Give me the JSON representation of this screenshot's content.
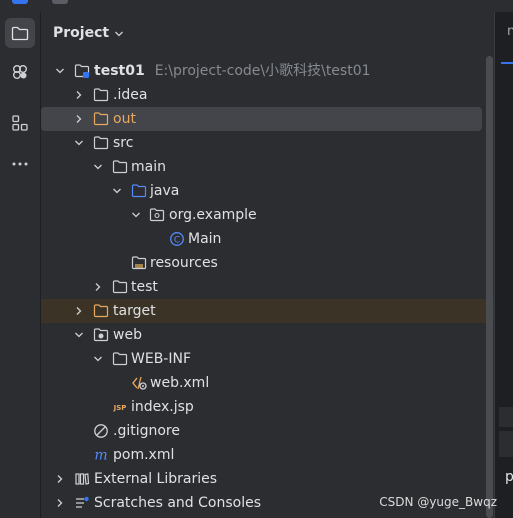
{
  "panel": {
    "title": "Project"
  },
  "tree": {
    "root": {
      "name": "test01",
      "path": "E:\\project-code\\小歌科技\\test01"
    },
    "idea": ".idea",
    "out": "out",
    "src": "src",
    "main": "main",
    "java": "java",
    "package": "org.example",
    "main_class": "Main",
    "resources": "resources",
    "test": "test",
    "target": "target",
    "web": "web",
    "web_inf": "WEB-INF",
    "web_xml": "web.xml",
    "index_jsp": "index.jsp",
    "gitignore": ".gitignore",
    "pom": "pom.xml",
    "external_libraries": "External Libraries",
    "scratches": "Scratches and Consoles"
  },
  "editor": {
    "tab_fragment": "n",
    "bottom_fragment": "p"
  },
  "watermark": "CSDN @yuge_Bwqz",
  "colors": {
    "background": "#2b2d30",
    "selection": "#43454a",
    "excluded_highlight": "#3b3426",
    "excluded_text": "#e8a85f",
    "accent_blue": "#3574f0",
    "folder_grey": "#ced0d6",
    "source_blue": "#548af7"
  },
  "icons": {
    "activity": [
      "project-folder-icon",
      "plugins-icon",
      "structure-icon",
      "more-icon"
    ]
  }
}
